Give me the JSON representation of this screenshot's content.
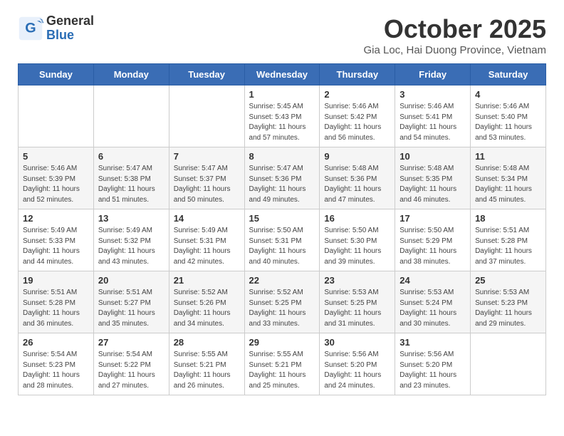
{
  "header": {
    "logo_general": "General",
    "logo_blue": "Blue",
    "month_title": "October 2025",
    "location": "Gia Loc, Hai Duong Province, Vietnam"
  },
  "days_of_week": [
    "Sunday",
    "Monday",
    "Tuesday",
    "Wednesday",
    "Thursday",
    "Friday",
    "Saturday"
  ],
  "weeks": [
    [
      {
        "day": "",
        "info": ""
      },
      {
        "day": "",
        "info": ""
      },
      {
        "day": "",
        "info": ""
      },
      {
        "day": "1",
        "info": "Sunrise: 5:45 AM\nSunset: 5:43 PM\nDaylight: 11 hours\nand 57 minutes."
      },
      {
        "day": "2",
        "info": "Sunrise: 5:46 AM\nSunset: 5:42 PM\nDaylight: 11 hours\nand 56 minutes."
      },
      {
        "day": "3",
        "info": "Sunrise: 5:46 AM\nSunset: 5:41 PM\nDaylight: 11 hours\nand 54 minutes."
      },
      {
        "day": "4",
        "info": "Sunrise: 5:46 AM\nSunset: 5:40 PM\nDaylight: 11 hours\nand 53 minutes."
      }
    ],
    [
      {
        "day": "5",
        "info": "Sunrise: 5:46 AM\nSunset: 5:39 PM\nDaylight: 11 hours\nand 52 minutes."
      },
      {
        "day": "6",
        "info": "Sunrise: 5:47 AM\nSunset: 5:38 PM\nDaylight: 11 hours\nand 51 minutes."
      },
      {
        "day": "7",
        "info": "Sunrise: 5:47 AM\nSunset: 5:37 PM\nDaylight: 11 hours\nand 50 minutes."
      },
      {
        "day": "8",
        "info": "Sunrise: 5:47 AM\nSunset: 5:36 PM\nDaylight: 11 hours\nand 49 minutes."
      },
      {
        "day": "9",
        "info": "Sunrise: 5:48 AM\nSunset: 5:36 PM\nDaylight: 11 hours\nand 47 minutes."
      },
      {
        "day": "10",
        "info": "Sunrise: 5:48 AM\nSunset: 5:35 PM\nDaylight: 11 hours\nand 46 minutes."
      },
      {
        "day": "11",
        "info": "Sunrise: 5:48 AM\nSunset: 5:34 PM\nDaylight: 11 hours\nand 45 minutes."
      }
    ],
    [
      {
        "day": "12",
        "info": "Sunrise: 5:49 AM\nSunset: 5:33 PM\nDaylight: 11 hours\nand 44 minutes."
      },
      {
        "day": "13",
        "info": "Sunrise: 5:49 AM\nSunset: 5:32 PM\nDaylight: 11 hours\nand 43 minutes."
      },
      {
        "day": "14",
        "info": "Sunrise: 5:49 AM\nSunset: 5:31 PM\nDaylight: 11 hours\nand 42 minutes."
      },
      {
        "day": "15",
        "info": "Sunrise: 5:50 AM\nSunset: 5:31 PM\nDaylight: 11 hours\nand 40 minutes."
      },
      {
        "day": "16",
        "info": "Sunrise: 5:50 AM\nSunset: 5:30 PM\nDaylight: 11 hours\nand 39 minutes."
      },
      {
        "day": "17",
        "info": "Sunrise: 5:50 AM\nSunset: 5:29 PM\nDaylight: 11 hours\nand 38 minutes."
      },
      {
        "day": "18",
        "info": "Sunrise: 5:51 AM\nSunset: 5:28 PM\nDaylight: 11 hours\nand 37 minutes."
      }
    ],
    [
      {
        "day": "19",
        "info": "Sunrise: 5:51 AM\nSunset: 5:28 PM\nDaylight: 11 hours\nand 36 minutes."
      },
      {
        "day": "20",
        "info": "Sunrise: 5:51 AM\nSunset: 5:27 PM\nDaylight: 11 hours\nand 35 minutes."
      },
      {
        "day": "21",
        "info": "Sunrise: 5:52 AM\nSunset: 5:26 PM\nDaylight: 11 hours\nand 34 minutes."
      },
      {
        "day": "22",
        "info": "Sunrise: 5:52 AM\nSunset: 5:25 PM\nDaylight: 11 hours\nand 33 minutes."
      },
      {
        "day": "23",
        "info": "Sunrise: 5:53 AM\nSunset: 5:25 PM\nDaylight: 11 hours\nand 31 minutes."
      },
      {
        "day": "24",
        "info": "Sunrise: 5:53 AM\nSunset: 5:24 PM\nDaylight: 11 hours\nand 30 minutes."
      },
      {
        "day": "25",
        "info": "Sunrise: 5:53 AM\nSunset: 5:23 PM\nDaylight: 11 hours\nand 29 minutes."
      }
    ],
    [
      {
        "day": "26",
        "info": "Sunrise: 5:54 AM\nSunset: 5:23 PM\nDaylight: 11 hours\nand 28 minutes."
      },
      {
        "day": "27",
        "info": "Sunrise: 5:54 AM\nSunset: 5:22 PM\nDaylight: 11 hours\nand 27 minutes."
      },
      {
        "day": "28",
        "info": "Sunrise: 5:55 AM\nSunset: 5:21 PM\nDaylight: 11 hours\nand 26 minutes."
      },
      {
        "day": "29",
        "info": "Sunrise: 5:55 AM\nSunset: 5:21 PM\nDaylight: 11 hours\nand 25 minutes."
      },
      {
        "day": "30",
        "info": "Sunrise: 5:56 AM\nSunset: 5:20 PM\nDaylight: 11 hours\nand 24 minutes."
      },
      {
        "day": "31",
        "info": "Sunrise: 5:56 AM\nSunset: 5:20 PM\nDaylight: 11 hours\nand 23 minutes."
      },
      {
        "day": "",
        "info": ""
      }
    ]
  ]
}
